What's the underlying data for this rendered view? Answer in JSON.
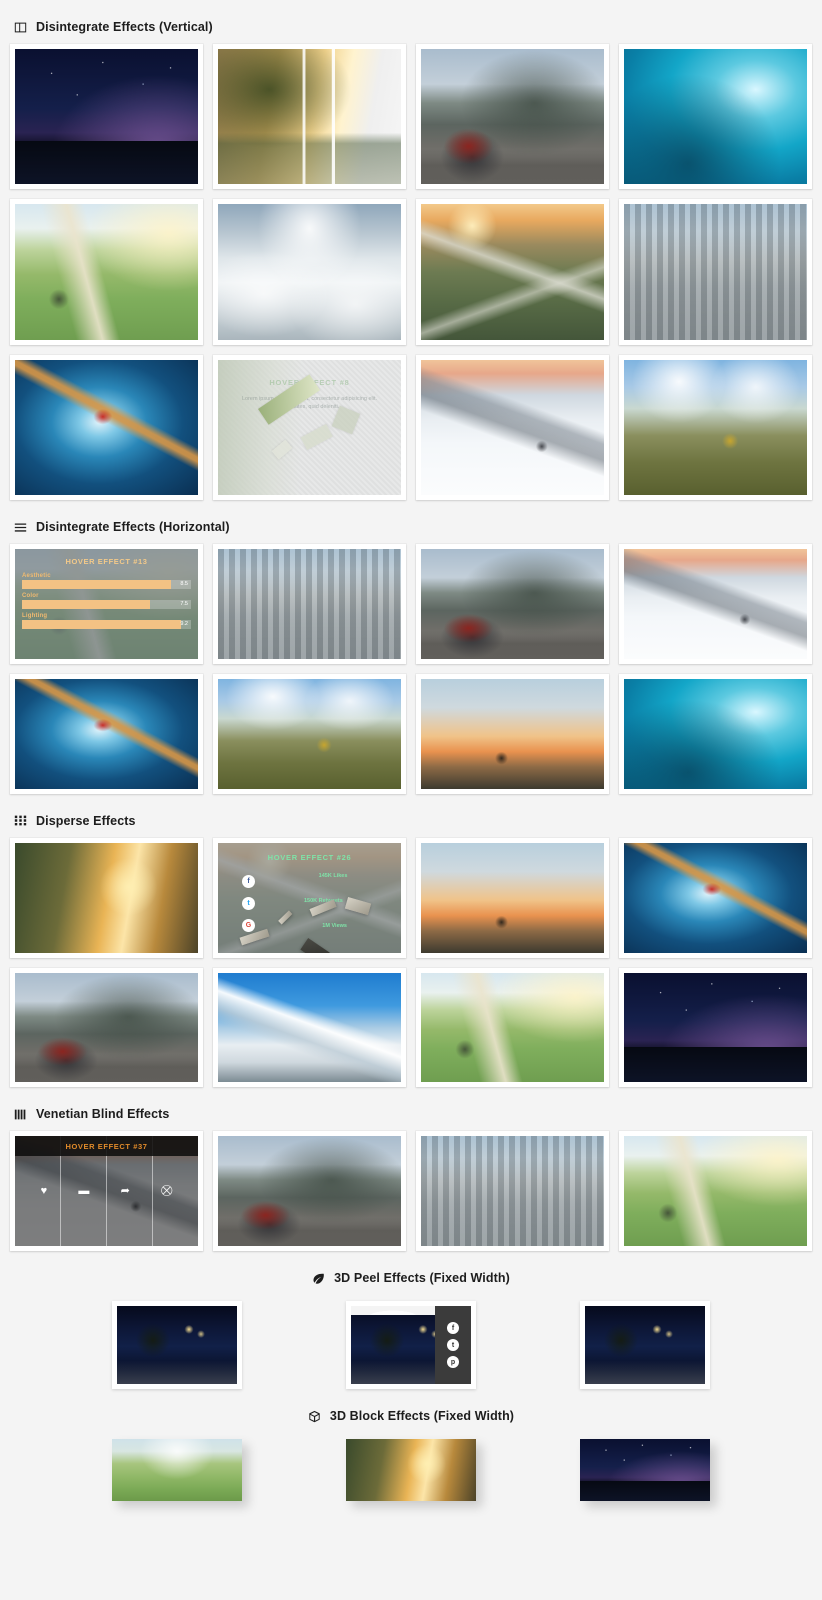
{
  "sections": [
    {
      "id": "disintegrate-vertical",
      "title": "Disintegrate Effects (Vertical)",
      "icon": "columns-icon",
      "layout": "grid-4",
      "orientation": "vertical",
      "items": [
        {
          "name": "starry-night-lake",
          "style": "p-stars"
        },
        {
          "name": "forest-lake-sliced",
          "style": "p-forest"
        },
        {
          "name": "kayak-truck-volcano",
          "style": "p-kayak"
        },
        {
          "name": "ocean-wave",
          "style": "p-wave"
        },
        {
          "name": "cyclists-green-meadow",
          "style": "p-bike"
        },
        {
          "name": "sea-of-clouds",
          "style": "p-clouds"
        },
        {
          "name": "winding-mountain-road",
          "style": "p-road"
        },
        {
          "name": "city-skyline",
          "style": "p-city"
        },
        {
          "name": "ice-cave-climber",
          "style": "p-cave"
        },
        {
          "name": "disintegrate-text-overlay",
          "style": "p-textfx",
          "overlay": "hover8"
        },
        {
          "name": "skier-snow-slope",
          "style": "p-ski"
        },
        {
          "name": "mountain-biker-clouds",
          "style": "p-mtbike"
        }
      ]
    },
    {
      "id": "disintegrate-horizontal",
      "title": "Disintegrate Effects (Horizontal)",
      "icon": "rows-icon",
      "layout": "grid-4",
      "orientation": "horizontal",
      "items": [
        {
          "name": "skill-bars-overlay",
          "style": "p-bike",
          "overlay": "hover13"
        },
        {
          "name": "city-skyline",
          "style": "p-city"
        },
        {
          "name": "kayak-truck-volcano",
          "style": "p-kayak"
        },
        {
          "name": "skier-snow-slope",
          "style": "p-ski"
        },
        {
          "name": "ice-cave-climber",
          "style": "p-cave"
        },
        {
          "name": "mountain-biker-clouds",
          "style": "p-mtbike"
        },
        {
          "name": "cyclist-sunset",
          "style": "p-sunset"
        },
        {
          "name": "ocean-wave",
          "style": "p-wave"
        }
      ]
    },
    {
      "id": "disperse",
      "title": "Disperse Effects",
      "icon": "grid-dots-icon",
      "layout": "grid-4",
      "orientation": "horizontal",
      "items": [
        {
          "name": "forest-trail-sunlight",
          "style": "p-trail"
        },
        {
          "name": "social-stats-overlay",
          "style": "p-road",
          "overlay": "hover26"
        },
        {
          "name": "cyclist-sunset",
          "style": "p-sunset"
        },
        {
          "name": "ice-cave-climber",
          "style": "p-cave"
        },
        {
          "name": "kayak-truck-volcano",
          "style": "p-kayak"
        },
        {
          "name": "matterhorn-peak",
          "style": "p-matterhorn"
        },
        {
          "name": "cyclists-green-meadow",
          "style": "p-bike"
        },
        {
          "name": "starry-night-lake",
          "style": "p-stars"
        }
      ]
    },
    {
      "id": "venetian-blind",
      "title": "Venetian Blind Effects",
      "icon": "blinds-icon",
      "layout": "grid-4",
      "orientation": "horizontal",
      "items": [
        {
          "name": "action-icons-overlay",
          "style": "p-ski",
          "overlay": "hover37"
        },
        {
          "name": "kayak-truck-volcano",
          "style": "p-kayak"
        },
        {
          "name": "city-skyline",
          "style": "p-city"
        },
        {
          "name": "cyclists-green-meadow",
          "style": "p-bike"
        }
      ]
    },
    {
      "id": "peel-3d",
      "title": "3D Peel Effects (Fixed Width)",
      "icon": "leaf-icon",
      "layout": "fixed-row",
      "items": [
        {
          "name": "palm-boulevard-night",
          "style": "p-palms"
        },
        {
          "name": "palm-boulevard-night-peeled",
          "style": "p-palms",
          "overlay": "peel"
        },
        {
          "name": "palm-boulevard-night",
          "style": "p-palms"
        }
      ]
    },
    {
      "id": "block-3d",
      "title": "3D Block Effects (Fixed Width)",
      "icon": "cube-icon",
      "layout": "block-row",
      "items": [
        {
          "name": "alpine-meadow",
          "style": "p-meadow"
        },
        {
          "name": "forest-trail-sunlight",
          "style": "p-trail"
        },
        {
          "name": "starry-night-lake",
          "style": "p-stars"
        }
      ]
    }
  ],
  "overlays": {
    "hover8": {
      "title": "HOVER EFFECT #8",
      "body": "Lorem ipsum dolor sit amet, consectetur adipisicing elit. Voluptates, quid deleniti."
    },
    "hover13": {
      "title": "HOVER EFFECT #13",
      "skills": [
        {
          "label": "Aesthetic",
          "value": "8.5",
          "pct": 88
        },
        {
          "label": "Color",
          "value": "7.5",
          "pct": 76
        },
        {
          "label": "Lighting",
          "value": "9.2",
          "pct": 94
        }
      ]
    },
    "hover26": {
      "title": "HOVER EFFECT #26",
      "socials": [
        {
          "name": "facebook-icon",
          "glyph": "f"
        },
        {
          "name": "twitter-icon",
          "glyph": "t"
        },
        {
          "name": "google-plus-icon",
          "glyph": "G"
        }
      ],
      "stats": [
        "145K Likes",
        "150K Retweets",
        "1M Views"
      ]
    },
    "hover37": {
      "title": "HOVER EFFECT #37",
      "actions": [
        {
          "name": "favorite-icon",
          "glyph": "♥"
        },
        {
          "name": "folder-icon",
          "glyph": "▬"
        },
        {
          "name": "share-icon",
          "glyph": "➦"
        },
        {
          "name": "cart-icon",
          "glyph": "⛒"
        }
      ]
    },
    "peel": {
      "buttons": [
        {
          "name": "facebook-icon",
          "glyph": "f"
        },
        {
          "name": "twitter-icon",
          "glyph": "t"
        },
        {
          "name": "pinterest-icon",
          "glyph": "p"
        }
      ]
    }
  },
  "colors": {
    "page_bg": "#f4f4f4",
    "card_bg": "#ffffff",
    "heading": "#1d1d1d",
    "accent_orange": "#e08a2a",
    "accent_green": "#7fe3a8",
    "accent_tan": "#f3c284"
  }
}
